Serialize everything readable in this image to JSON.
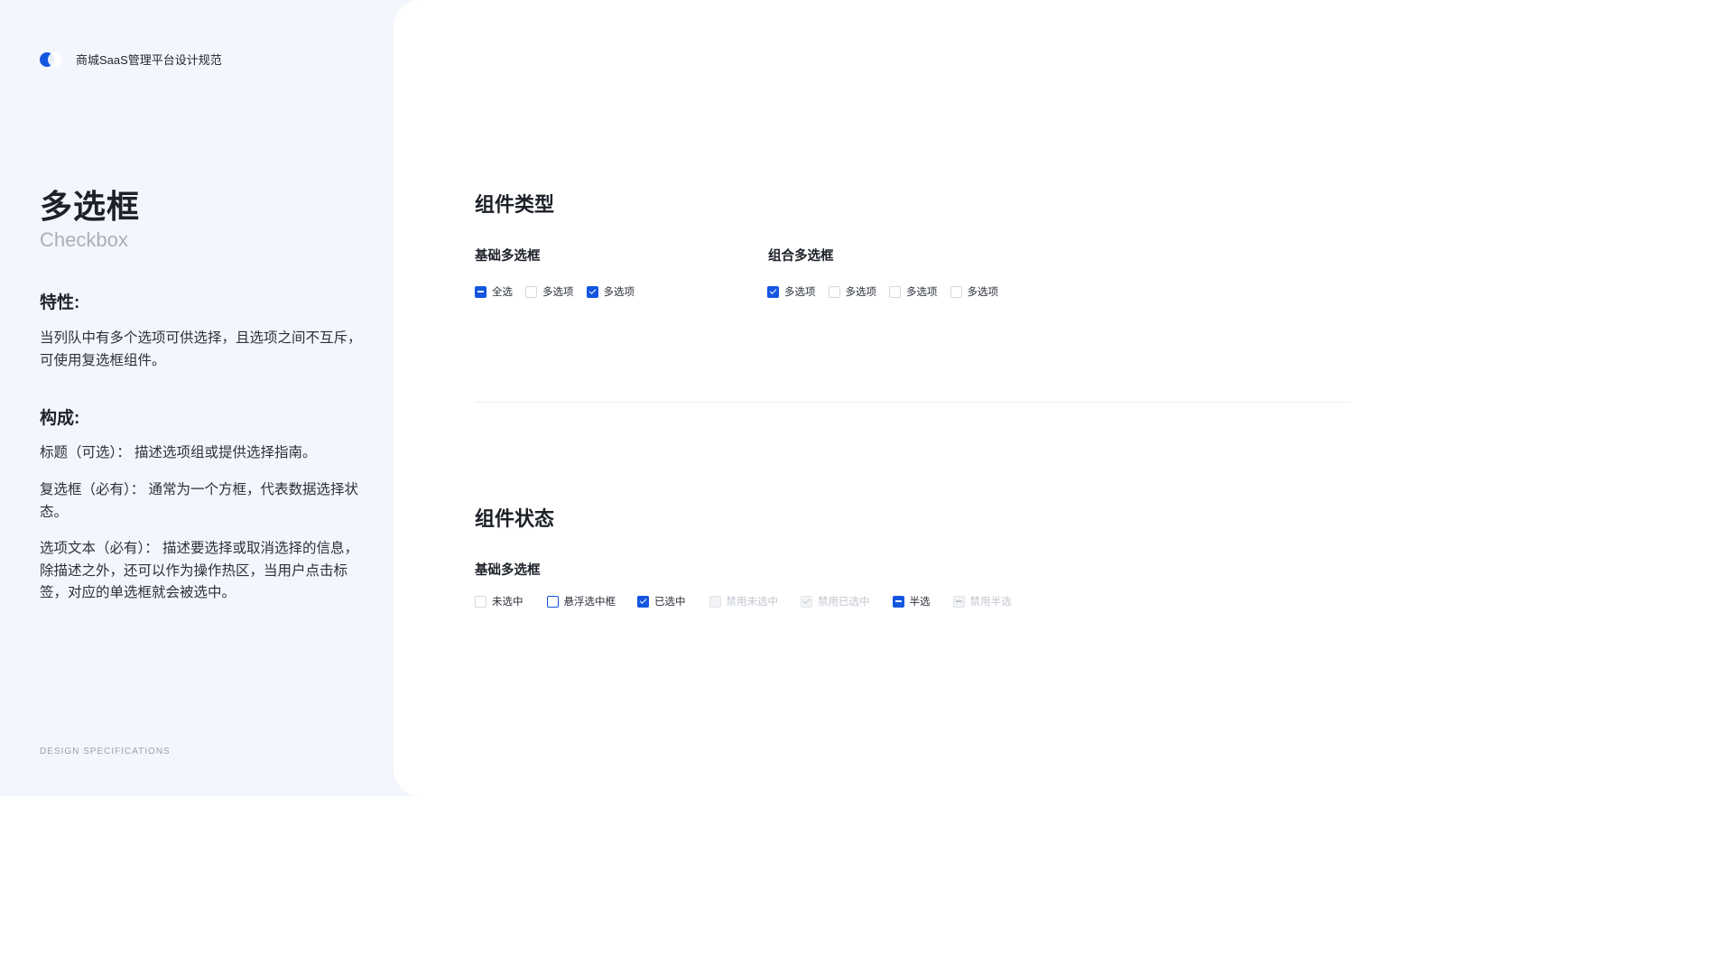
{
  "brand": {
    "name": "商城SaaS管理平台设计规范"
  },
  "page": {
    "title_cn": "多选框",
    "title_en": "Checkbox"
  },
  "features": {
    "heading": "特性:",
    "text": "当列队中有多个选项可供选择，且选项之间不互斥，可使用复选框组件。"
  },
  "composition": {
    "heading": "构成:",
    "items": [
      "标题（可选）：  描述选项组或提供选择指南。",
      "复选框（必有）：  通常为一个方框，代表数据选择状态。",
      "选项文本（必有）：  描述要选择或取消选择的信息，除描述之外，还可以作为操作热区，当用户点击标签，对应的单选框就会被选中。"
    ]
  },
  "footer": {
    "text": "DESIGN SPECIFICATIONS"
  },
  "types": {
    "heading": "组件类型",
    "basic": {
      "title": "基础多选框",
      "options": [
        {
          "label": "全选",
          "state": "indeterminate"
        },
        {
          "label": "多选项",
          "state": "unchecked"
        },
        {
          "label": "多选项",
          "state": "checked"
        }
      ]
    },
    "combo": {
      "title": "组合多选框",
      "options": [
        {
          "label": "多选项",
          "state": "checked"
        },
        {
          "label": "多选项",
          "state": "unchecked"
        },
        {
          "label": "多选项",
          "state": "unchecked"
        },
        {
          "label": "多选项",
          "state": "unchecked"
        }
      ]
    }
  },
  "states": {
    "heading": "组件状态",
    "basic": {
      "title": "基础多选框",
      "options": [
        {
          "label": "未选中",
          "state": "unchecked"
        },
        {
          "label": "悬浮选中框",
          "state": "hover"
        },
        {
          "label": "已选中",
          "state": "checked"
        },
        {
          "label": "禁用未选中",
          "state": "disabled-unchecked"
        },
        {
          "label": "禁用已选中",
          "state": "disabled-checked"
        },
        {
          "label": "半选",
          "state": "indeterminate"
        },
        {
          "label": "禁用半选",
          "state": "disabled-indeterminate"
        }
      ]
    }
  },
  "colors": {
    "primary": "#1456e0",
    "panel_bg": "#f3f6fc",
    "text": "#1d2129",
    "muted": "#a9b0bd"
  }
}
